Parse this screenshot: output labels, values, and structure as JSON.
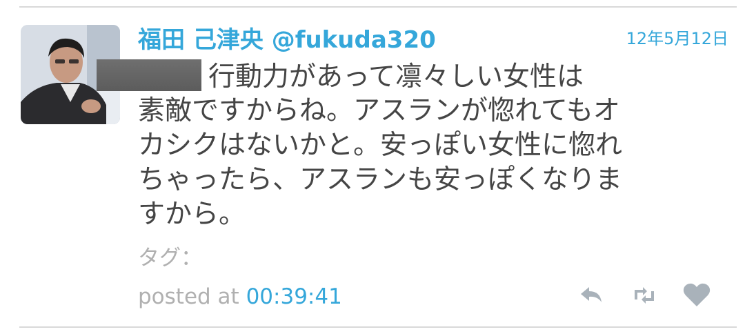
{
  "tweet": {
    "author_name": "福田 己津央",
    "author_handle": "@fukuda320",
    "date": "12年5月12日",
    "text_lines": [
      "行動力があって凛々しい女性は",
      "素敵ですからね。アスランが惚れてもオ",
      "カシクはないかと。安っぽい女性に惚れ",
      "ちゃったら、アスランも安っぽくなりま",
      "すから。"
    ],
    "tags_label": "タグ：",
    "posted_label": "posted at",
    "posted_time": "00:39:41"
  },
  "icons": {
    "reply": "reply-icon",
    "retweet": "retweet-icon",
    "favorite": "heart-icon"
  },
  "colors": {
    "accent": "#35a7da",
    "muted": "#b0b0b0",
    "icon": "#a9b2ba"
  }
}
